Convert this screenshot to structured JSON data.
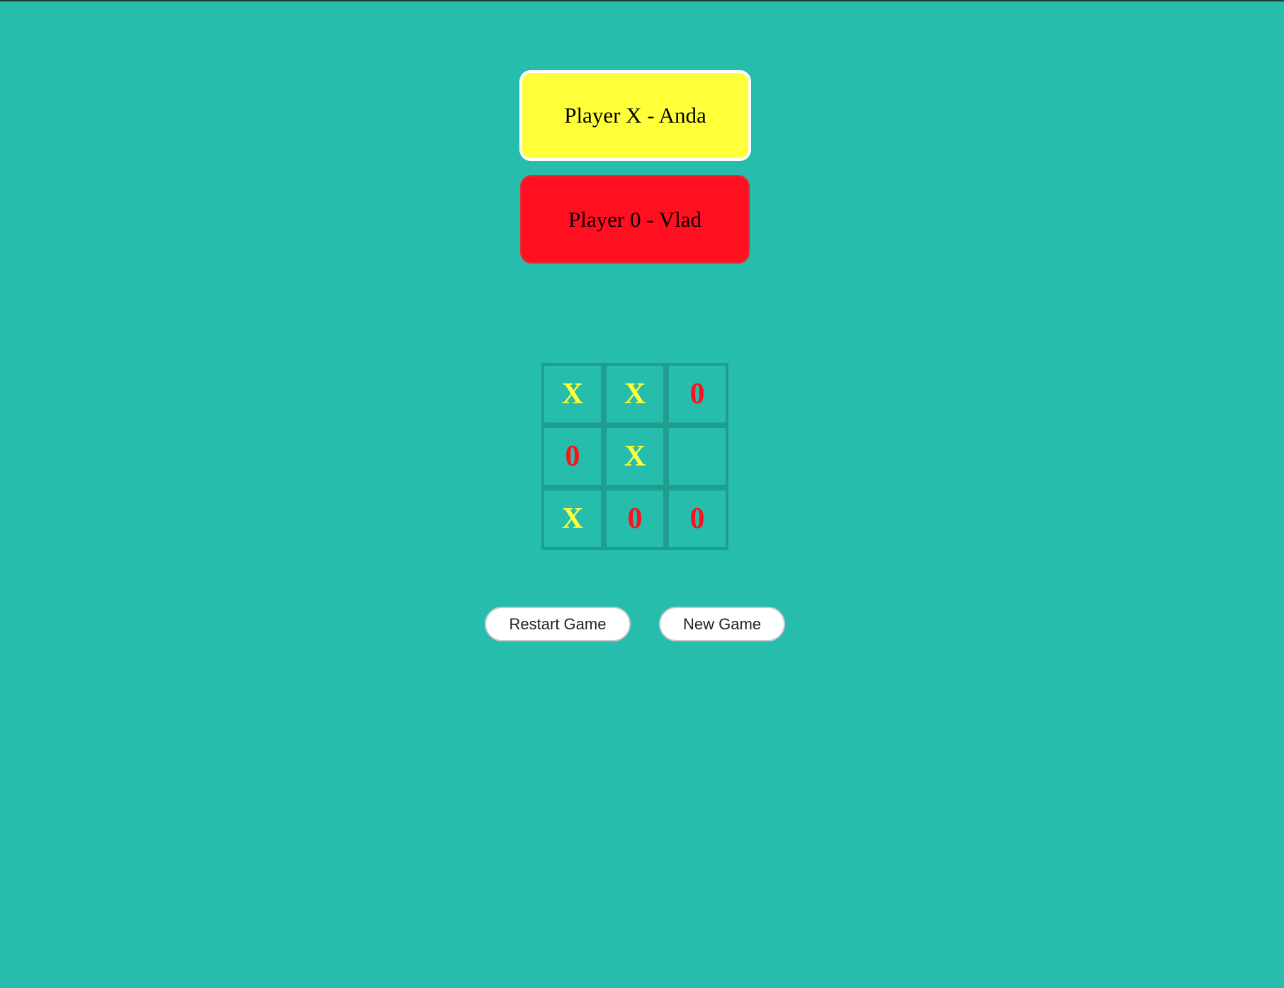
{
  "players": {
    "x": {
      "label": "Player X - Anda",
      "color": "#ffff3a",
      "active": true
    },
    "o": {
      "label": "Player 0 - Vlad",
      "color": "#ff0f1f",
      "active": false
    }
  },
  "board": {
    "cells": [
      "X",
      "X",
      "0",
      "0",
      "X",
      "",
      "X",
      "0",
      "0"
    ],
    "x_color": "#ffff3a",
    "o_color": "#ff0f1f"
  },
  "buttons": {
    "restart": "Restart Game",
    "new_game": "New Game"
  }
}
